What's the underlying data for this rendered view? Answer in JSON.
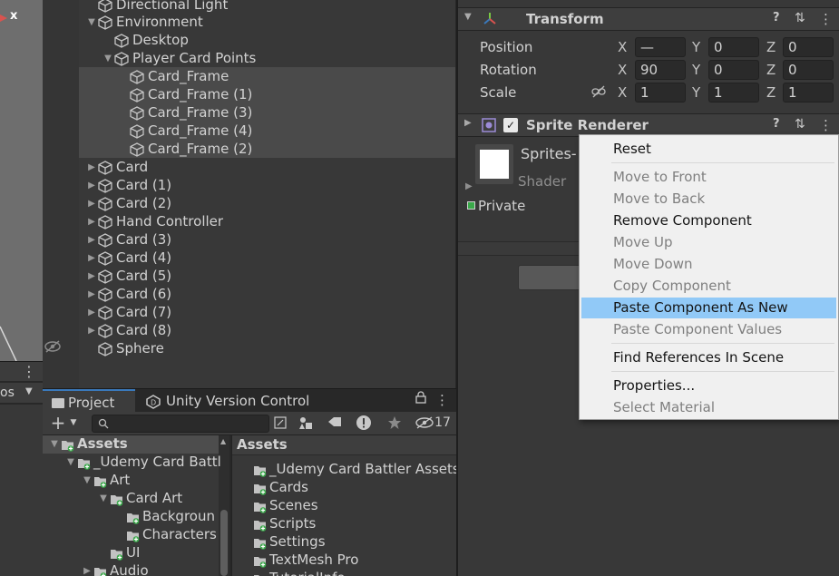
{
  "colors": {
    "accent": "#3a79bb",
    "menu_highlight": "#91c9f7",
    "menu_bg": "#f0f0f0",
    "unity_dark": "#383838"
  },
  "scene": {
    "close_glyph": "x"
  },
  "left_toolbar": {
    "stub_label": "os",
    "more_glyph": "⋮",
    "dropdown_glyph": "▼"
  },
  "hierarchy": {
    "rows": [
      {
        "label": "Directional Light",
        "arrow": ""
      },
      {
        "label": "Environment",
        "arrow": "▼"
      },
      {
        "label": "Desktop",
        "arrow": ""
      },
      {
        "label": "Player Card Points",
        "arrow": "▼"
      },
      {
        "label": "Card_Frame",
        "arrow": ""
      },
      {
        "label": "Card_Frame (1)",
        "arrow": ""
      },
      {
        "label": "Card_Frame (3)",
        "arrow": ""
      },
      {
        "label": "Card_Frame (4)",
        "arrow": ""
      },
      {
        "label": "Card_Frame (2)",
        "arrow": ""
      },
      {
        "label": "Card",
        "arrow": "▶"
      },
      {
        "label": "Card (1)",
        "arrow": "▶"
      },
      {
        "label": "Card (2)",
        "arrow": "▶"
      },
      {
        "label": "Hand Controller",
        "arrow": "▶"
      },
      {
        "label": "Card (3)",
        "arrow": "▶"
      },
      {
        "label": "Card (4)",
        "arrow": "▶"
      },
      {
        "label": "Card (5)",
        "arrow": "▶"
      },
      {
        "label": "Card (6)",
        "arrow": "▶"
      },
      {
        "label": "Card (7)",
        "arrow": "▶"
      },
      {
        "label": "Card (8)",
        "arrow": "▶"
      },
      {
        "label": "Sphere",
        "arrow": ""
      }
    ]
  },
  "project": {
    "tabs": [
      {
        "label": "Project",
        "icon": "folder-icon"
      },
      {
        "label": "Unity Version Control",
        "icon": "unity-vc-icon"
      }
    ],
    "tab_lock_glyph": "🔒",
    "tab_more_glyph": "⋮",
    "toolbar": {
      "add_glyph": "+",
      "add_dropdown_glyph": "▼",
      "hidden_count": "17"
    },
    "search": {
      "value": "",
      "placeholder": ""
    },
    "tree": [
      {
        "label": "Assets",
        "arrow": "▼",
        "bold": true
      },
      {
        "label": "_Udemy Card Battl",
        "arrow": "▼"
      },
      {
        "label": "Art",
        "arrow": "▼"
      },
      {
        "label": "Card Art",
        "arrow": "▼"
      },
      {
        "label": "Backgroun",
        "arrow": ""
      },
      {
        "label": "Characters",
        "arrow": ""
      },
      {
        "label": "UI",
        "arrow": ""
      },
      {
        "label": "Audio",
        "arrow": "▶"
      }
    ],
    "list_header": "Assets",
    "list": [
      {
        "label": "_Udemy Card Battler Assets"
      },
      {
        "label": "Cards"
      },
      {
        "label": "Scenes"
      },
      {
        "label": "Scripts"
      },
      {
        "label": "Settings"
      },
      {
        "label": "TextMesh Pro"
      },
      {
        "label": "TutorialInfo"
      }
    ]
  },
  "inspector": {
    "transform": {
      "title": "Transform",
      "collapse_glyph": "▼",
      "help_glyph": "?",
      "settings_glyph": "⇅",
      "more_glyph": "⋮",
      "rows": [
        {
          "label": "Position",
          "x": "—",
          "y": "0",
          "z": "0"
        },
        {
          "label": "Rotation",
          "x": "90",
          "y": "0",
          "z": "0"
        },
        {
          "label": "Scale",
          "x": "1",
          "y": "1",
          "z": "1"
        }
      ],
      "axis_x": "X",
      "axis_y": "Y",
      "axis_z": "Z"
    },
    "sprite_renderer": {
      "title": "Sprite Renderer",
      "enabled": true,
      "checkmark_glyph": "✓",
      "collapse_glyph": "▶",
      "help_glyph": "?",
      "settings_glyph": "⇅",
      "more_glyph": "⋮",
      "material_name": "Sprites-",
      "shader_label": "Shader",
      "private_label": "Private",
      "expand_glyph": "▶"
    }
  },
  "context_menu": {
    "items": [
      {
        "label": "Reset",
        "disabled": false
      },
      {
        "label": "Move to Front",
        "disabled": true
      },
      {
        "label": "Move to Back",
        "disabled": true
      },
      {
        "label": "Remove Component",
        "disabled": false
      },
      {
        "label": "Move Up",
        "disabled": true
      },
      {
        "label": "Move Down",
        "disabled": true
      },
      {
        "label": "Copy Component",
        "disabled": true
      },
      {
        "label": "Paste Component As New",
        "disabled": false,
        "highlighted": true
      },
      {
        "label": "Paste Component Values",
        "disabled": true
      },
      {
        "label": "Find References In Scene",
        "disabled": false
      },
      {
        "label": "Properties...",
        "disabled": false
      },
      {
        "label": "Select Material",
        "disabled": true
      }
    ]
  }
}
